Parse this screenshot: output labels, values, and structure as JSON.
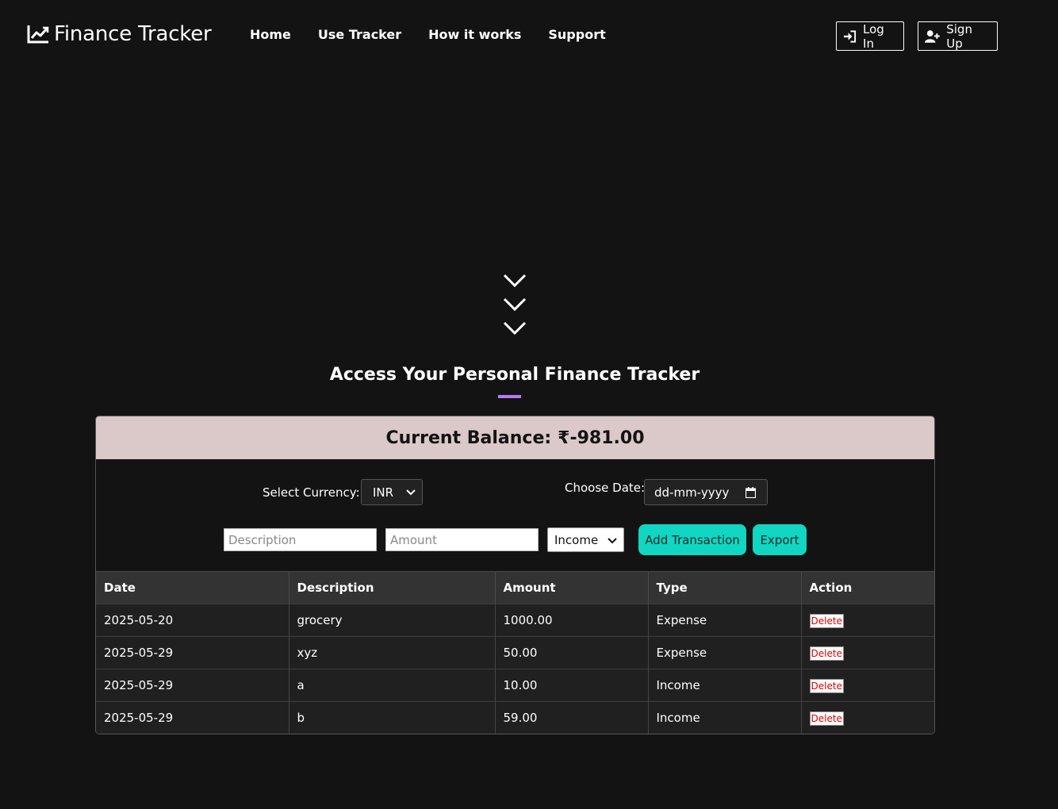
{
  "header": {
    "brand": "Finance Tracker",
    "nav": [
      "Home",
      "Use Tracker",
      "How it works",
      "Support"
    ],
    "login_label": "Log In",
    "signup_label": "Sign Up"
  },
  "section": {
    "title": "Access Your Personal Finance Tracker",
    "accent_color": "#b57af2"
  },
  "balance": {
    "label": "Current Balance:",
    "value": "₹-981.00"
  },
  "controls": {
    "currency_label": "Select Currency:",
    "currency_value": "INR",
    "date_label": "Choose Date:",
    "date_placeholder": "dd-mm-yyyy",
    "description_placeholder": "Description",
    "amount_placeholder": "Amount",
    "type_value": "Income",
    "add_label": "Add Transaction",
    "export_label": "Export",
    "button_color": "#10d6c2"
  },
  "table": {
    "headers": [
      "Date",
      "Description",
      "Amount",
      "Type",
      "Action"
    ],
    "rows": [
      {
        "date": "2025-05-20",
        "description": "grocery",
        "amount": "1000.00",
        "type": "Expense",
        "action": "Delete"
      },
      {
        "date": "2025-05-29",
        "description": "xyz",
        "amount": "50.00",
        "type": "Expense",
        "action": "Delete"
      },
      {
        "date": "2025-05-29",
        "description": "a",
        "amount": "10.00",
        "type": "Income",
        "action": "Delete"
      },
      {
        "date": "2025-05-29",
        "description": "b",
        "amount": "59.00",
        "type": "Income",
        "action": "Delete"
      }
    ]
  },
  "icons": {
    "brand": "chart-line-icon",
    "login": "sign-in-icon",
    "signup": "user-plus-icon",
    "scroll": "chevron-down-icon"
  }
}
